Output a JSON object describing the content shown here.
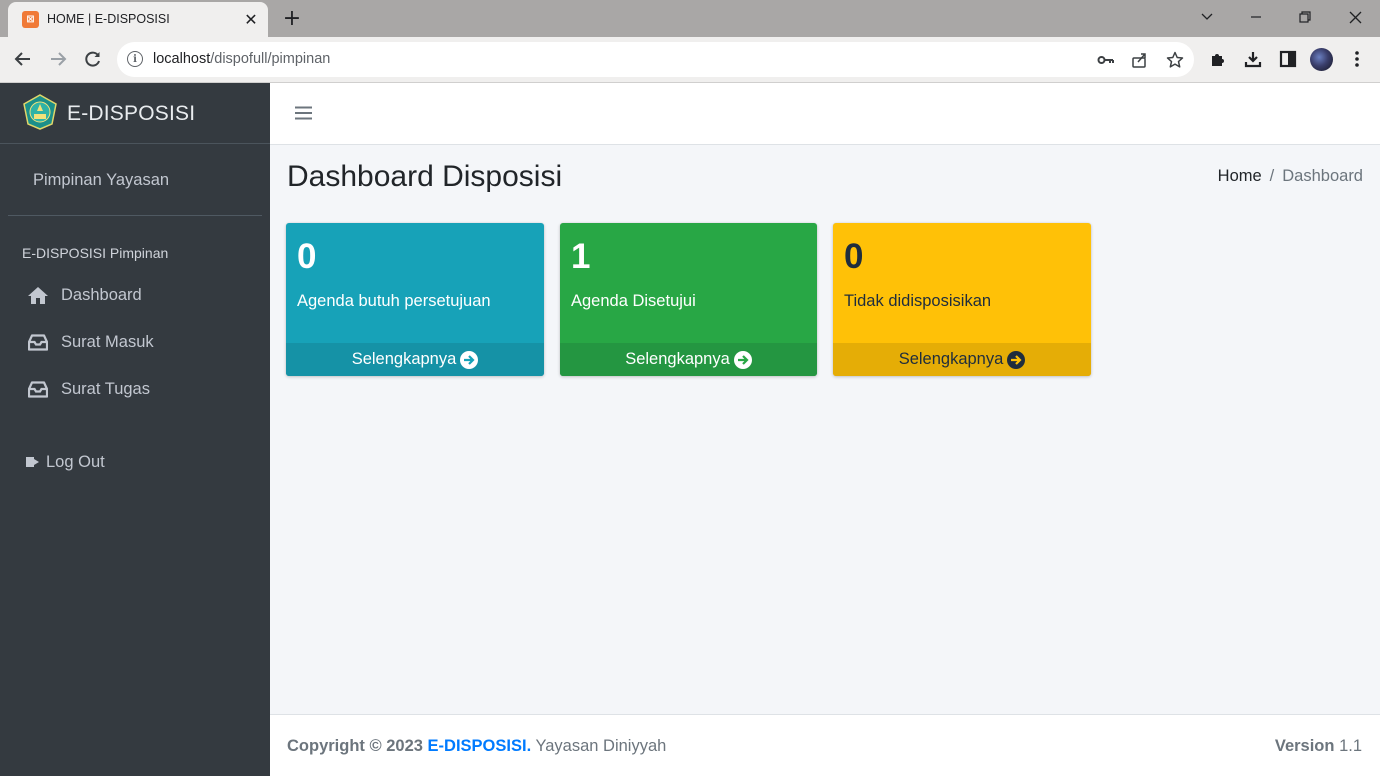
{
  "browser": {
    "tab_title": "HOME | E-DISPOSISI",
    "url_host": "localhost",
    "url_path": "/dispofull/pimpinan"
  },
  "sidebar": {
    "brand": "E-DISPOSISI",
    "user_name": "Pimpinan Yayasan",
    "nav_header": "E-DISPOSISI Pimpinan",
    "items": [
      {
        "label": "Dashboard",
        "icon": "home-icon"
      },
      {
        "label": "Surat Masuk",
        "icon": "inbox-icon"
      },
      {
        "label": "Surat Tugas",
        "icon": "inbox-icon"
      }
    ],
    "logout_label": "Log Out"
  },
  "content": {
    "title": "Dashboard Disposisi",
    "breadcrumb": {
      "home": "Home",
      "separator": "/",
      "current": "Dashboard"
    },
    "boxes": [
      {
        "count": "0",
        "label": "Agenda butuh persetujuan",
        "footer": "Selengkapnya",
        "color": "#17a2b8"
      },
      {
        "count": "1",
        "label": "Agenda Disetujui",
        "footer": "Selengkapnya",
        "color": "#28a745"
      },
      {
        "count": "0",
        "label": "Tidak didisposisikan",
        "footer": "Selengkapnya",
        "color": "#ffc107"
      }
    ]
  },
  "footer": {
    "copyright_prefix": "Copyright © 2023",
    "app_name": "E-DISPOSISI.",
    "org": "Yayasan Diniyyah",
    "version_label": "Version",
    "version_number": "1.1"
  },
  "colors": {
    "sidebar_bg": "#343a40",
    "content_bg": "#f4f6f9",
    "link": "#007bff"
  }
}
